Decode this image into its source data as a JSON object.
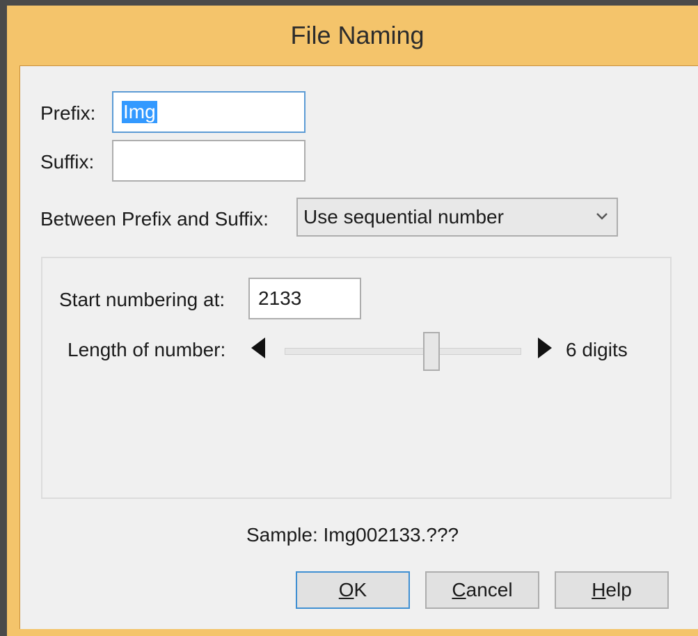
{
  "window": {
    "title": "File Naming"
  },
  "prefix": {
    "label": "Prefix:",
    "value": "Img"
  },
  "suffix": {
    "label": "Suffix:",
    "value": ""
  },
  "between": {
    "label": "Between Prefix and Suffix:",
    "selected": "Use sequential number"
  },
  "numbering": {
    "start_label": "Start numbering at:",
    "start_value": "2133",
    "length_label": "Length of number:",
    "length_value_text": "6 digits",
    "slider_fraction": 0.62
  },
  "sample": {
    "text": "Sample: Img002133.???"
  },
  "buttons": {
    "ok": {
      "mnemonic": "O",
      "rest": "K"
    },
    "cancel": {
      "mnemonic": "C",
      "rest": "ancel"
    },
    "help": {
      "mnemonic": "H",
      "rest": "elp"
    }
  },
  "colors": {
    "title_bar": "#f4c46b",
    "selection": "#3399ff",
    "focus_border": "#5b9bd5"
  }
}
